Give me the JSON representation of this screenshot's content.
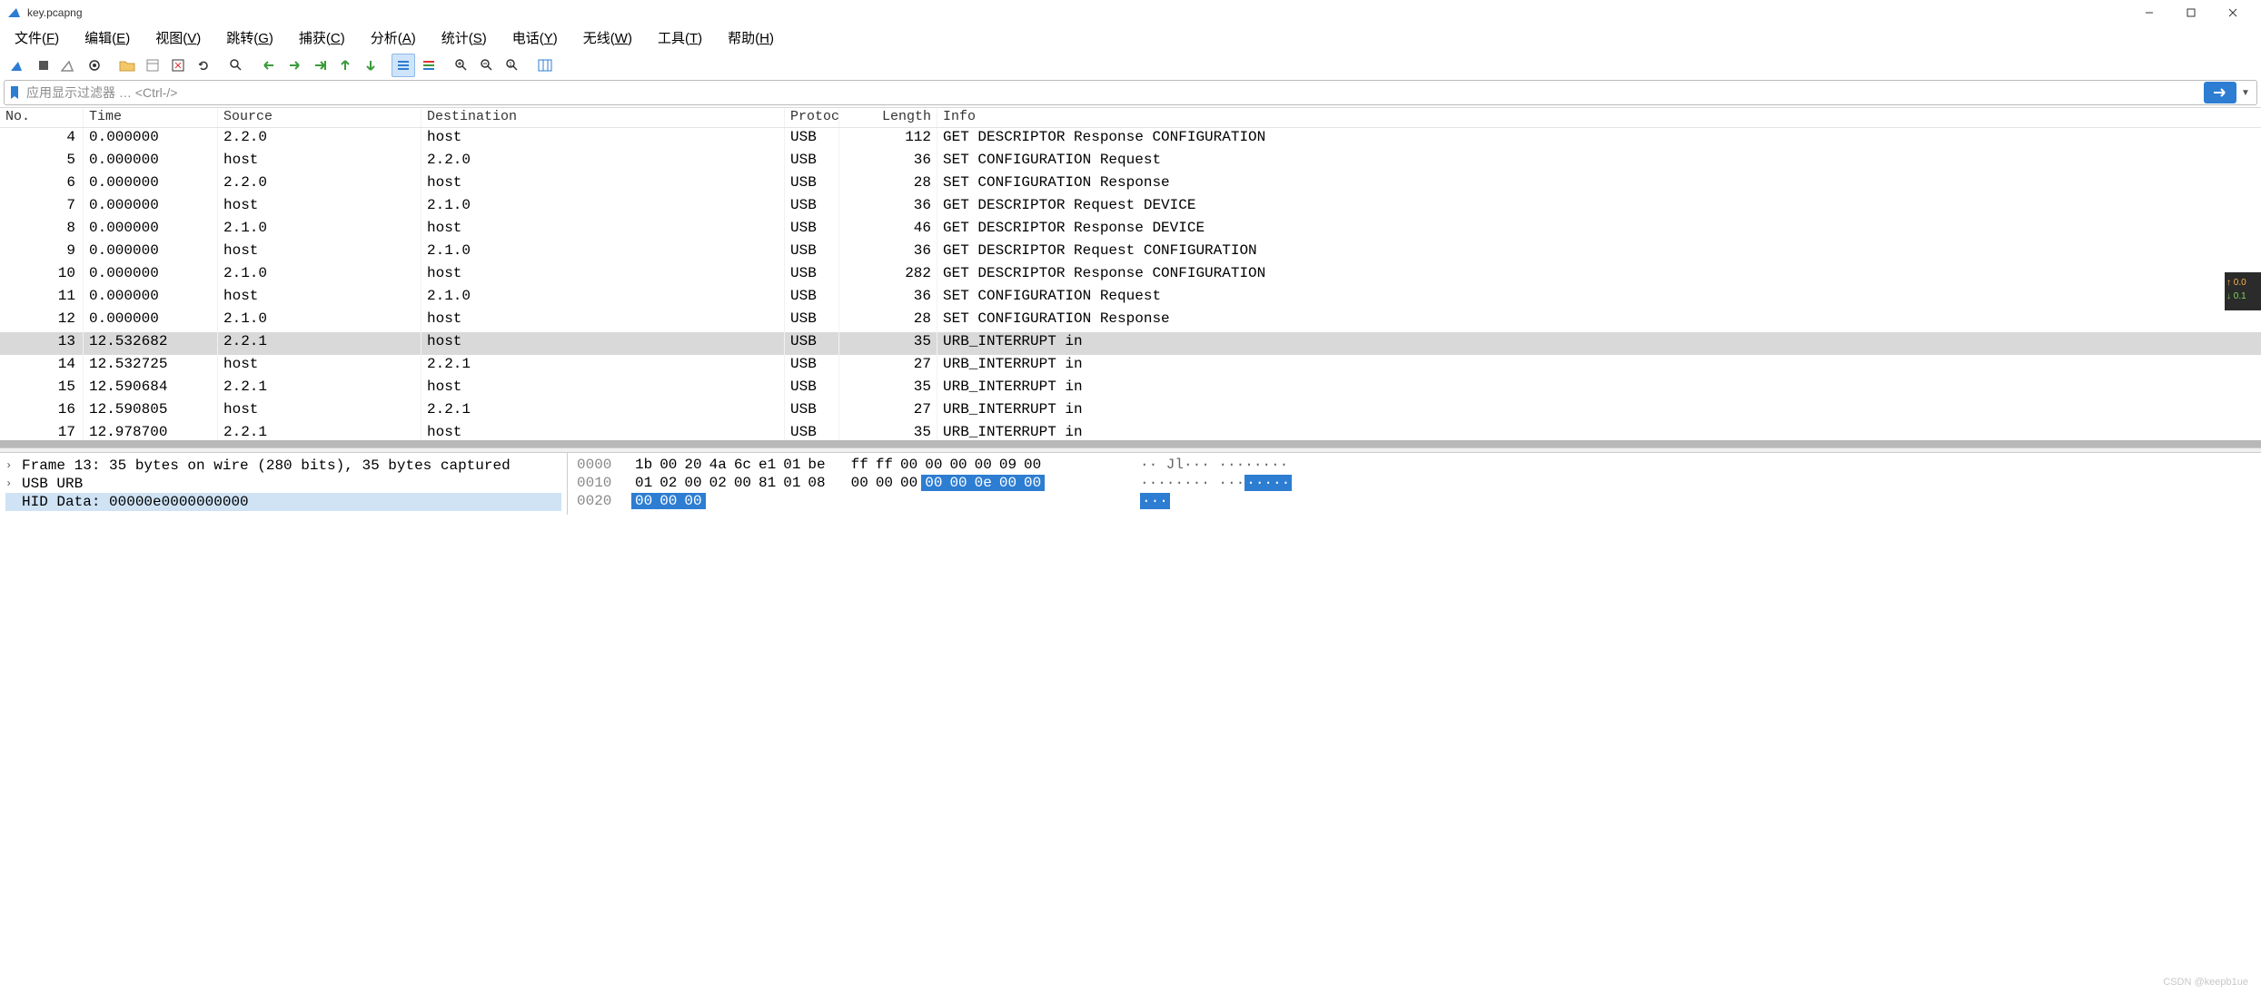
{
  "window": {
    "title": "key.pcapng"
  },
  "menus": [
    {
      "label": "文件",
      "u": "F"
    },
    {
      "label": "编辑",
      "u": "E"
    },
    {
      "label": "视图",
      "u": "V"
    },
    {
      "label": "跳转",
      "u": "G"
    },
    {
      "label": "捕获",
      "u": "C"
    },
    {
      "label": "分析",
      "u": "A"
    },
    {
      "label": "统计",
      "u": "S"
    },
    {
      "label": "电话",
      "u": "Y"
    },
    {
      "label": "无线",
      "u": "W"
    },
    {
      "label": "工具",
      "u": "T"
    },
    {
      "label": "帮助",
      "u": "H"
    }
  ],
  "filter": {
    "placeholder": "应用显示过滤器 … <Ctrl-/>"
  },
  "columns": {
    "no": "No.",
    "time": "Time",
    "src": "Source",
    "dst": "Destination",
    "proto": "Protoc",
    "len": "Length",
    "info": "Info"
  },
  "packets": [
    {
      "no": "4",
      "time": "0.000000",
      "src": "2.2.0",
      "dst": "host",
      "proto": "USB",
      "len": "112",
      "info": "GET DESCRIPTOR Response CONFIGURATION"
    },
    {
      "no": "5",
      "time": "0.000000",
      "src": "host",
      "dst": "2.2.0",
      "proto": "USB",
      "len": "36",
      "info": "SET CONFIGURATION Request"
    },
    {
      "no": "6",
      "time": "0.000000",
      "src": "2.2.0",
      "dst": "host",
      "proto": "USB",
      "len": "28",
      "info": "SET CONFIGURATION Response"
    },
    {
      "no": "7",
      "time": "0.000000",
      "src": "host",
      "dst": "2.1.0",
      "proto": "USB",
      "len": "36",
      "info": "GET DESCRIPTOR Request DEVICE"
    },
    {
      "no": "8",
      "time": "0.000000",
      "src": "2.1.0",
      "dst": "host",
      "proto": "USB",
      "len": "46",
      "info": "GET DESCRIPTOR Response DEVICE"
    },
    {
      "no": "9",
      "time": "0.000000",
      "src": "host",
      "dst": "2.1.0",
      "proto": "USB",
      "len": "36",
      "info": "GET DESCRIPTOR Request CONFIGURATION"
    },
    {
      "no": "10",
      "time": "0.000000",
      "src": "2.1.0",
      "dst": "host",
      "proto": "USB",
      "len": "282",
      "info": "GET DESCRIPTOR Response CONFIGURATION"
    },
    {
      "no": "11",
      "time": "0.000000",
      "src": "host",
      "dst": "2.1.0",
      "proto": "USB",
      "len": "36",
      "info": "SET CONFIGURATION Request"
    },
    {
      "no": "12",
      "time": "0.000000",
      "src": "2.1.0",
      "dst": "host",
      "proto": "USB",
      "len": "28",
      "info": "SET CONFIGURATION Response"
    },
    {
      "no": "13",
      "time": "12.532682",
      "src": "2.2.1",
      "dst": "host",
      "proto": "USB",
      "len": "35",
      "info": "URB_INTERRUPT in",
      "sel": true
    },
    {
      "no": "14",
      "time": "12.532725",
      "src": "host",
      "dst": "2.2.1",
      "proto": "USB",
      "len": "27",
      "info": "URB_INTERRUPT in"
    },
    {
      "no": "15",
      "time": "12.590684",
      "src": "2.2.1",
      "dst": "host",
      "proto": "USB",
      "len": "35",
      "info": "URB_INTERRUPT in"
    },
    {
      "no": "16",
      "time": "12.590805",
      "src": "host",
      "dst": "2.2.1",
      "proto": "USB",
      "len": "27",
      "info": "URB_INTERRUPT in"
    },
    {
      "no": "17",
      "time": "12.978700",
      "src": "2.2.1",
      "dst": "host",
      "proto": "USB",
      "len": "35",
      "info": "URB_INTERRUPT in"
    }
  ],
  "detail": {
    "frame": "Frame 13: 35 bytes on wire (280 bits), 35 bytes captured",
    "urb": "USB URB",
    "hid": "HID Data: 00000e0000000000"
  },
  "hex": {
    "lines": [
      {
        "off": "0000",
        "bytes": [
          "1b",
          "00",
          "20",
          "4a",
          "6c",
          "e1",
          "01",
          "be",
          "",
          "ff",
          "ff",
          "00",
          "00",
          "00",
          "00",
          "09",
          "00"
        ],
        "ascii": "·· Jl··· ········"
      },
      {
        "off": "0010",
        "bytes": [
          "01",
          "02",
          "00",
          "02",
          "00",
          "81",
          "01",
          "08",
          "",
          "00",
          "00",
          "00"
        ],
        "hl": [
          "00",
          "00",
          "0e",
          "00",
          "00"
        ],
        "ascii": "········ ···",
        "ascii_hl": "·····"
      },
      {
        "off": "0020",
        "bytes": [],
        "hl": [
          "00",
          "00",
          "00"
        ],
        "ascii": "",
        "ascii_hl": "···"
      }
    ]
  },
  "sidebadge": {
    "up": "0.0",
    "dn": "0.1"
  },
  "watermark": "CSDN @keepb1ue"
}
